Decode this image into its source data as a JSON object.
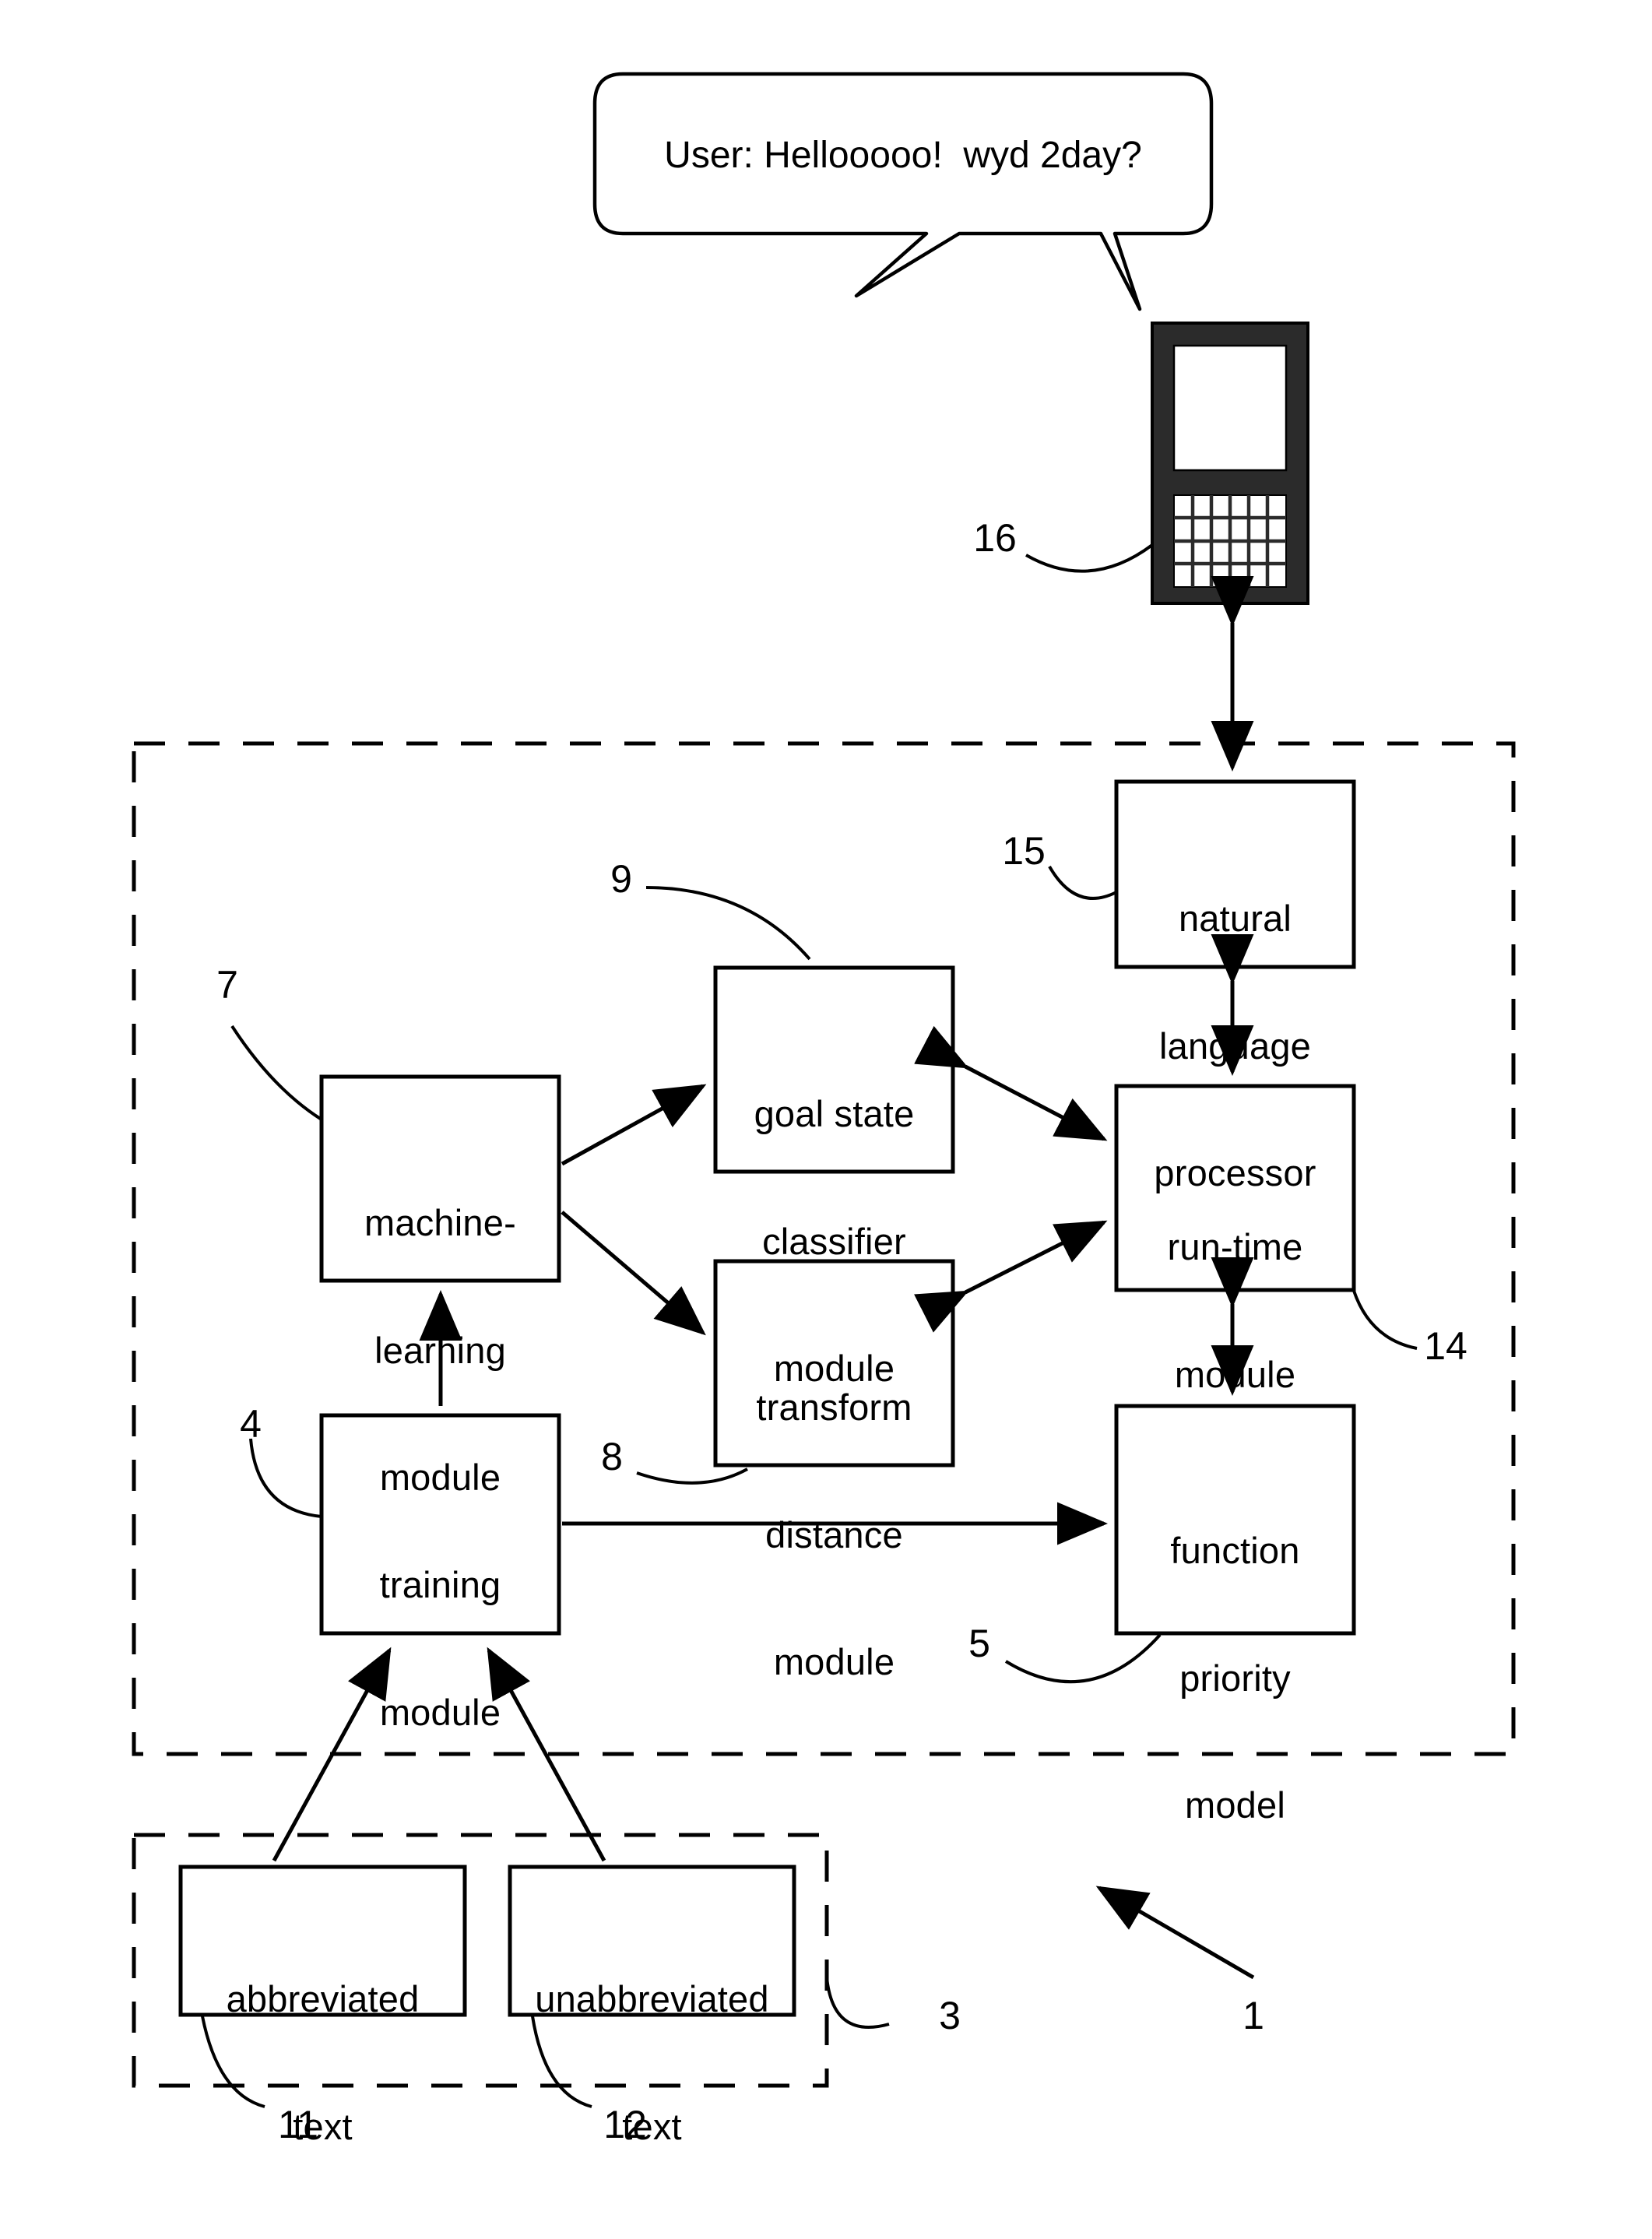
{
  "figure": {
    "type": "patent-block-diagram",
    "speech_bubble": {
      "text": "User: Hellooooo!  wyd 2day?"
    },
    "device": {
      "name": "mobile-phone",
      "reference_number": "16",
      "keypad_rows": 4,
      "keypad_cols": 6
    },
    "boxes": [
      {
        "id": "nlp",
        "label": "natural\nlanguage\nprocessor",
        "reference_number": "15"
      },
      {
        "id": "ml",
        "label": "machine-\nlearning\nmodule",
        "reference_number": "7"
      },
      {
        "id": "goal",
        "label": "goal state\nclassifier\nmodule",
        "reference_number": "9"
      },
      {
        "id": "xform",
        "label": "transform\ndistance\nmodule",
        "reference_number": "8"
      },
      {
        "id": "runtime",
        "label": "run-time\nmodule",
        "reference_number": "14"
      },
      {
        "id": "training",
        "label": "training\nmodule",
        "reference_number": "4"
      },
      {
        "id": "fpm",
        "label": "function\npriority\nmodel",
        "reference_number": "5"
      },
      {
        "id": "abbr",
        "label": "abbreviated\ntext",
        "reference_number": "11"
      },
      {
        "id": "unabbr",
        "label": "unabbreviated\ntext",
        "reference_number": "12"
      }
    ],
    "box_lines": {
      "nlp": [
        "natural",
        "language",
        "processor"
      ],
      "ml": [
        "machine-",
        "learning",
        "module"
      ],
      "goal": [
        "goal state",
        "classifier",
        "module"
      ],
      "xform": [
        "transform",
        "distance",
        "module"
      ],
      "runtime": [
        "run-time",
        "module"
      ],
      "training": [
        "training",
        "module"
      ],
      "fpm": [
        "function",
        "priority",
        "model"
      ],
      "abbr": [
        "abbreviated",
        "text"
      ],
      "unabbr": [
        "unabbreviated",
        "text"
      ]
    },
    "regions": [
      {
        "id": "system",
        "style": "dashed",
        "reference_number": "1"
      },
      {
        "id": "training-data",
        "style": "dashed",
        "reference_number": "3"
      }
    ],
    "reference_numbers": {
      "system": "1",
      "training_data_region": "3",
      "training_module": "4",
      "function_priority_model": "5",
      "machine_learning_module": "7",
      "transform_distance_module": "8",
      "goal_state_classifier_module": "9",
      "abbreviated_text": "11",
      "unabbreviated_text": "12",
      "run_time_module": "14",
      "natural_language_processor": "15",
      "mobile_device": "16"
    },
    "colors": {
      "ink": "#000000",
      "paper": "#ffffff",
      "device_body": "#2a2a2a",
      "device_screen": "#ffffff"
    }
  }
}
